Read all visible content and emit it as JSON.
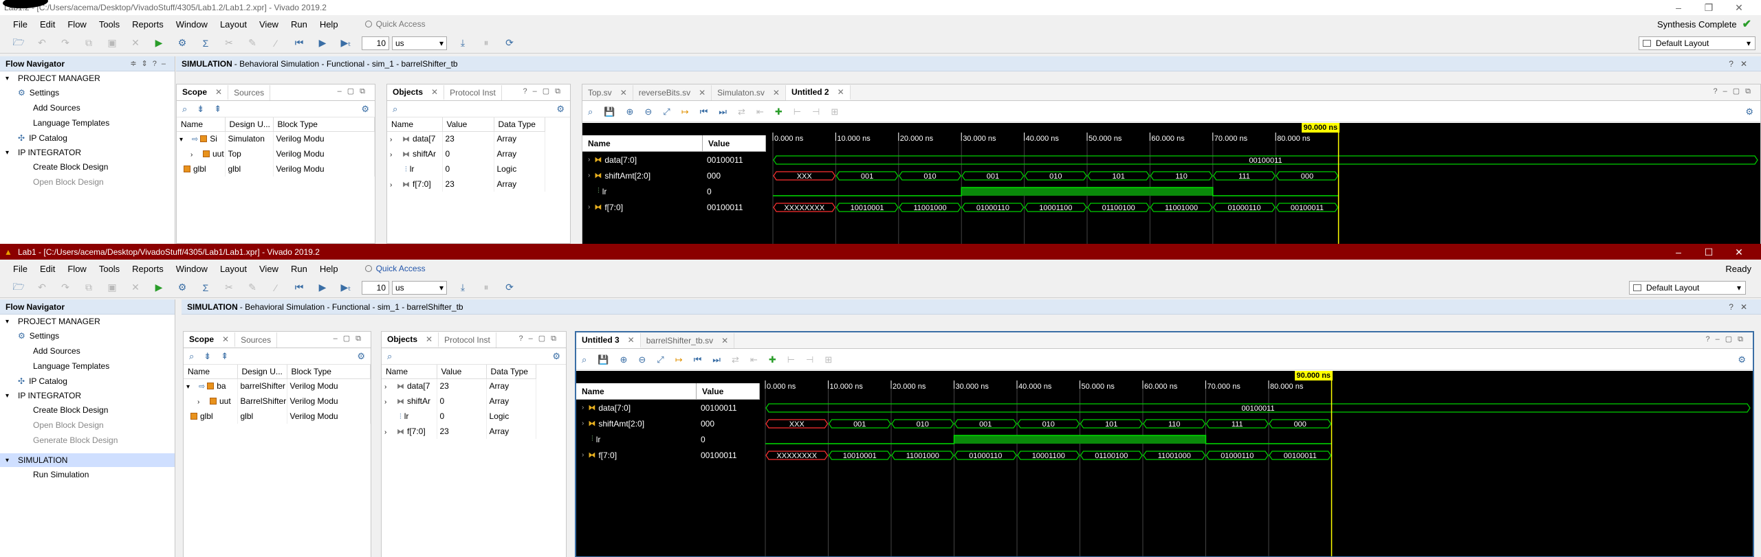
{
  "window1": {
    "title": "Lab1.2 - [C:/Users/acema/Desktop/VivadoStuff/4305/Lab1.2/Lab1.2.xpr] - Vivado 2019.2",
    "status": "Synthesis Complete",
    "quick_access_placeholder": "Quick Access",
    "tabs_editor": [
      {
        "label": "Top.sv",
        "active": false
      },
      {
        "label": "reverseBits.sv",
        "active": false
      },
      {
        "label": "Simulaton.sv",
        "active": false
      },
      {
        "label": "Untitled 2",
        "active": true
      }
    ],
    "scope_rows": [
      {
        "name": "Si",
        "design_unit": "Simulaton",
        "block_type": "Verilog Modu"
      },
      {
        "name": "uut",
        "design_unit": "Top",
        "block_type": "Verilog Modu"
      },
      {
        "name": "glbl",
        "design_unit": "glbl",
        "block_type": "Verilog Modu"
      }
    ],
    "object_rows": [
      {
        "name": "data[7",
        "value": "23",
        "type": "Array"
      },
      {
        "name": "shiftAr",
        "value": "0",
        "type": "Array"
      },
      {
        "name": "lr",
        "value": "0",
        "type": "Logic"
      },
      {
        "name": "f[7:0]",
        "value": "23",
        "type": "Array"
      }
    ]
  },
  "window2": {
    "title": "Lab1 - [C:/Users/acema/Desktop/VivadoStuff/4305/Lab1/Lab1.xpr] - Vivado 2019.2",
    "status": "Ready",
    "quick_access_placeholder": "Quick Access",
    "tabs_editor": [
      {
        "label": "Untitled 3",
        "active": true
      },
      {
        "label": "barrelShifter_tb.sv",
        "active": false
      }
    ],
    "scope_rows": [
      {
        "name": "ba",
        "design_unit": "barrelShifter",
        "block_type": "Verilog Modu"
      },
      {
        "name": "uut",
        "design_unit": "BarrelShifter",
        "block_type": "Verilog Modu"
      },
      {
        "name": "glbl",
        "design_unit": "glbl",
        "block_type": "Verilog Modu"
      }
    ],
    "object_rows": [
      {
        "name": "data[7",
        "value": "23",
        "type": "Array"
      },
      {
        "name": "shiftAr",
        "value": "0",
        "type": "Array"
      },
      {
        "name": "lr",
        "value": "0",
        "type": "Logic"
      },
      {
        "name": "f[7:0]",
        "value": "23",
        "type": "Array"
      }
    ]
  },
  "menu": [
    "File",
    "Edit",
    "Flow",
    "Tools",
    "Reports",
    "Window",
    "Layout",
    "View",
    "Run",
    "Help"
  ],
  "toolbar": {
    "run_time": "10",
    "run_unit": "us",
    "layout": "Default Layout"
  },
  "flow_navigator": {
    "title": "Flow Navigator",
    "project_manager": "PROJECT MANAGER",
    "settings": "Settings",
    "add_sources": "Add Sources",
    "language_templates": "Language Templates",
    "ip_catalog": "IP Catalog",
    "ip_integrator": "IP INTEGRATOR",
    "create_block_design": "Create Block Design",
    "open_block_design": "Open Block Design",
    "generate_block_design": "Generate Block Design",
    "simulation": "SIMULATION",
    "run_simulation": "Run Simulation"
  },
  "sim_header": {
    "bold": "SIMULATION",
    "text": "- Behavioral Simulation - Functional - sim_1 - barrelShifter_tb"
  },
  "scope_panel": {
    "tab_scope": "Scope",
    "tab_sources": "Sources",
    "col_name": "Name",
    "col_du": "Design U...",
    "col_du1": "Design Unit",
    "col_bt": "Block Type"
  },
  "objects_panel": {
    "tab_objects": "Objects",
    "tab_protocol": "Protocol Inst",
    "col_name": "Name",
    "col_value": "Value",
    "col_type": "Data Type"
  },
  "wave": {
    "col_name": "Name",
    "col_value": "Value",
    "cursor_label": "90.000 ns",
    "time_ticks": [
      "0.000 ns",
      "10.000 ns",
      "20.000 ns",
      "30.000 ns",
      "40.000 ns",
      "50.000 ns",
      "60.000 ns",
      "70.000 ns",
      "80.000 ns"
    ],
    "signals": [
      {
        "name": "data[7:0]",
        "value": "00100011",
        "kind": "bus",
        "segments": [
          "00100011"
        ]
      },
      {
        "name": "shiftAmt[2:0]",
        "value": "000",
        "kind": "bus",
        "segments": [
          "XXX",
          "001",
          "010",
          "001",
          "010",
          "101",
          "110",
          "111",
          "000"
        ]
      },
      {
        "name": "lr",
        "value": "0",
        "kind": "bit",
        "levels": [
          0,
          0,
          0,
          1,
          1,
          1,
          1,
          0,
          0
        ]
      },
      {
        "name": "f[7:0]",
        "value": "00100011",
        "kind": "bus",
        "segments": [
          "XXXXXXXX",
          "10010001",
          "11001000",
          "01000110",
          "10001100",
          "01100100",
          "11001000",
          "01000110",
          "00100011"
        ]
      }
    ]
  }
}
